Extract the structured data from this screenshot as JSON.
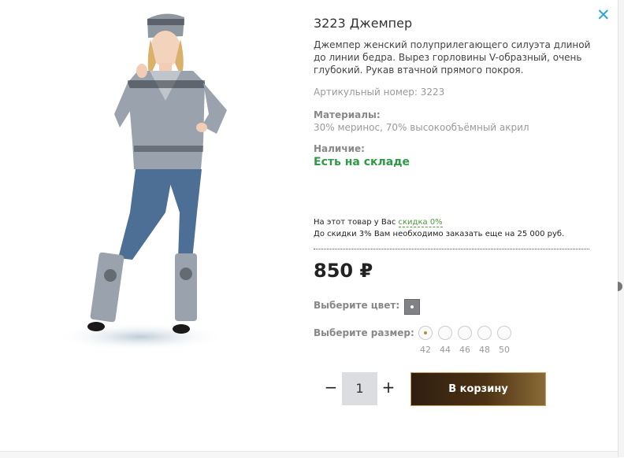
{
  "close_label": "✕",
  "product": {
    "title": "3223 Джемпер",
    "description": "Джемпер женский полуприлегающего силуэта длиной до линии бедра. Вырез горловины V-образный, очень глубокий. Рукав втачной прямого покроя.",
    "article": "Артикульный номер: 3223",
    "materials_label": "Материалы:",
    "materials_value": "30% меринос, 70% высокообъёмный акрил",
    "availability_label": "Наличие:",
    "availability_value": "Есть на складе"
  },
  "discount": {
    "line1_prefix": "На этот товар у Вас ",
    "line1_link": "скидка 0%",
    "line2": "До скидки 3% Вам необходимо заказать еще на 25 000 руб."
  },
  "price": "850 ₽",
  "color": {
    "label": "Выберите цвет:",
    "swatch_hex": "#808285"
  },
  "size": {
    "label": "Выберите размер:",
    "options": [
      "42",
      "44",
      "46",
      "48",
      "50"
    ],
    "selected": "42"
  },
  "quantity": {
    "minus": "−",
    "value": "1",
    "plus": "+"
  },
  "cart_button": "В корзину",
  "colors": {
    "accent_blue": "#2aa6d9",
    "in_stock_green": "#2e9a46",
    "sweater_gray": "#9aa3ad",
    "jeans_blue": "#4d6e95"
  }
}
